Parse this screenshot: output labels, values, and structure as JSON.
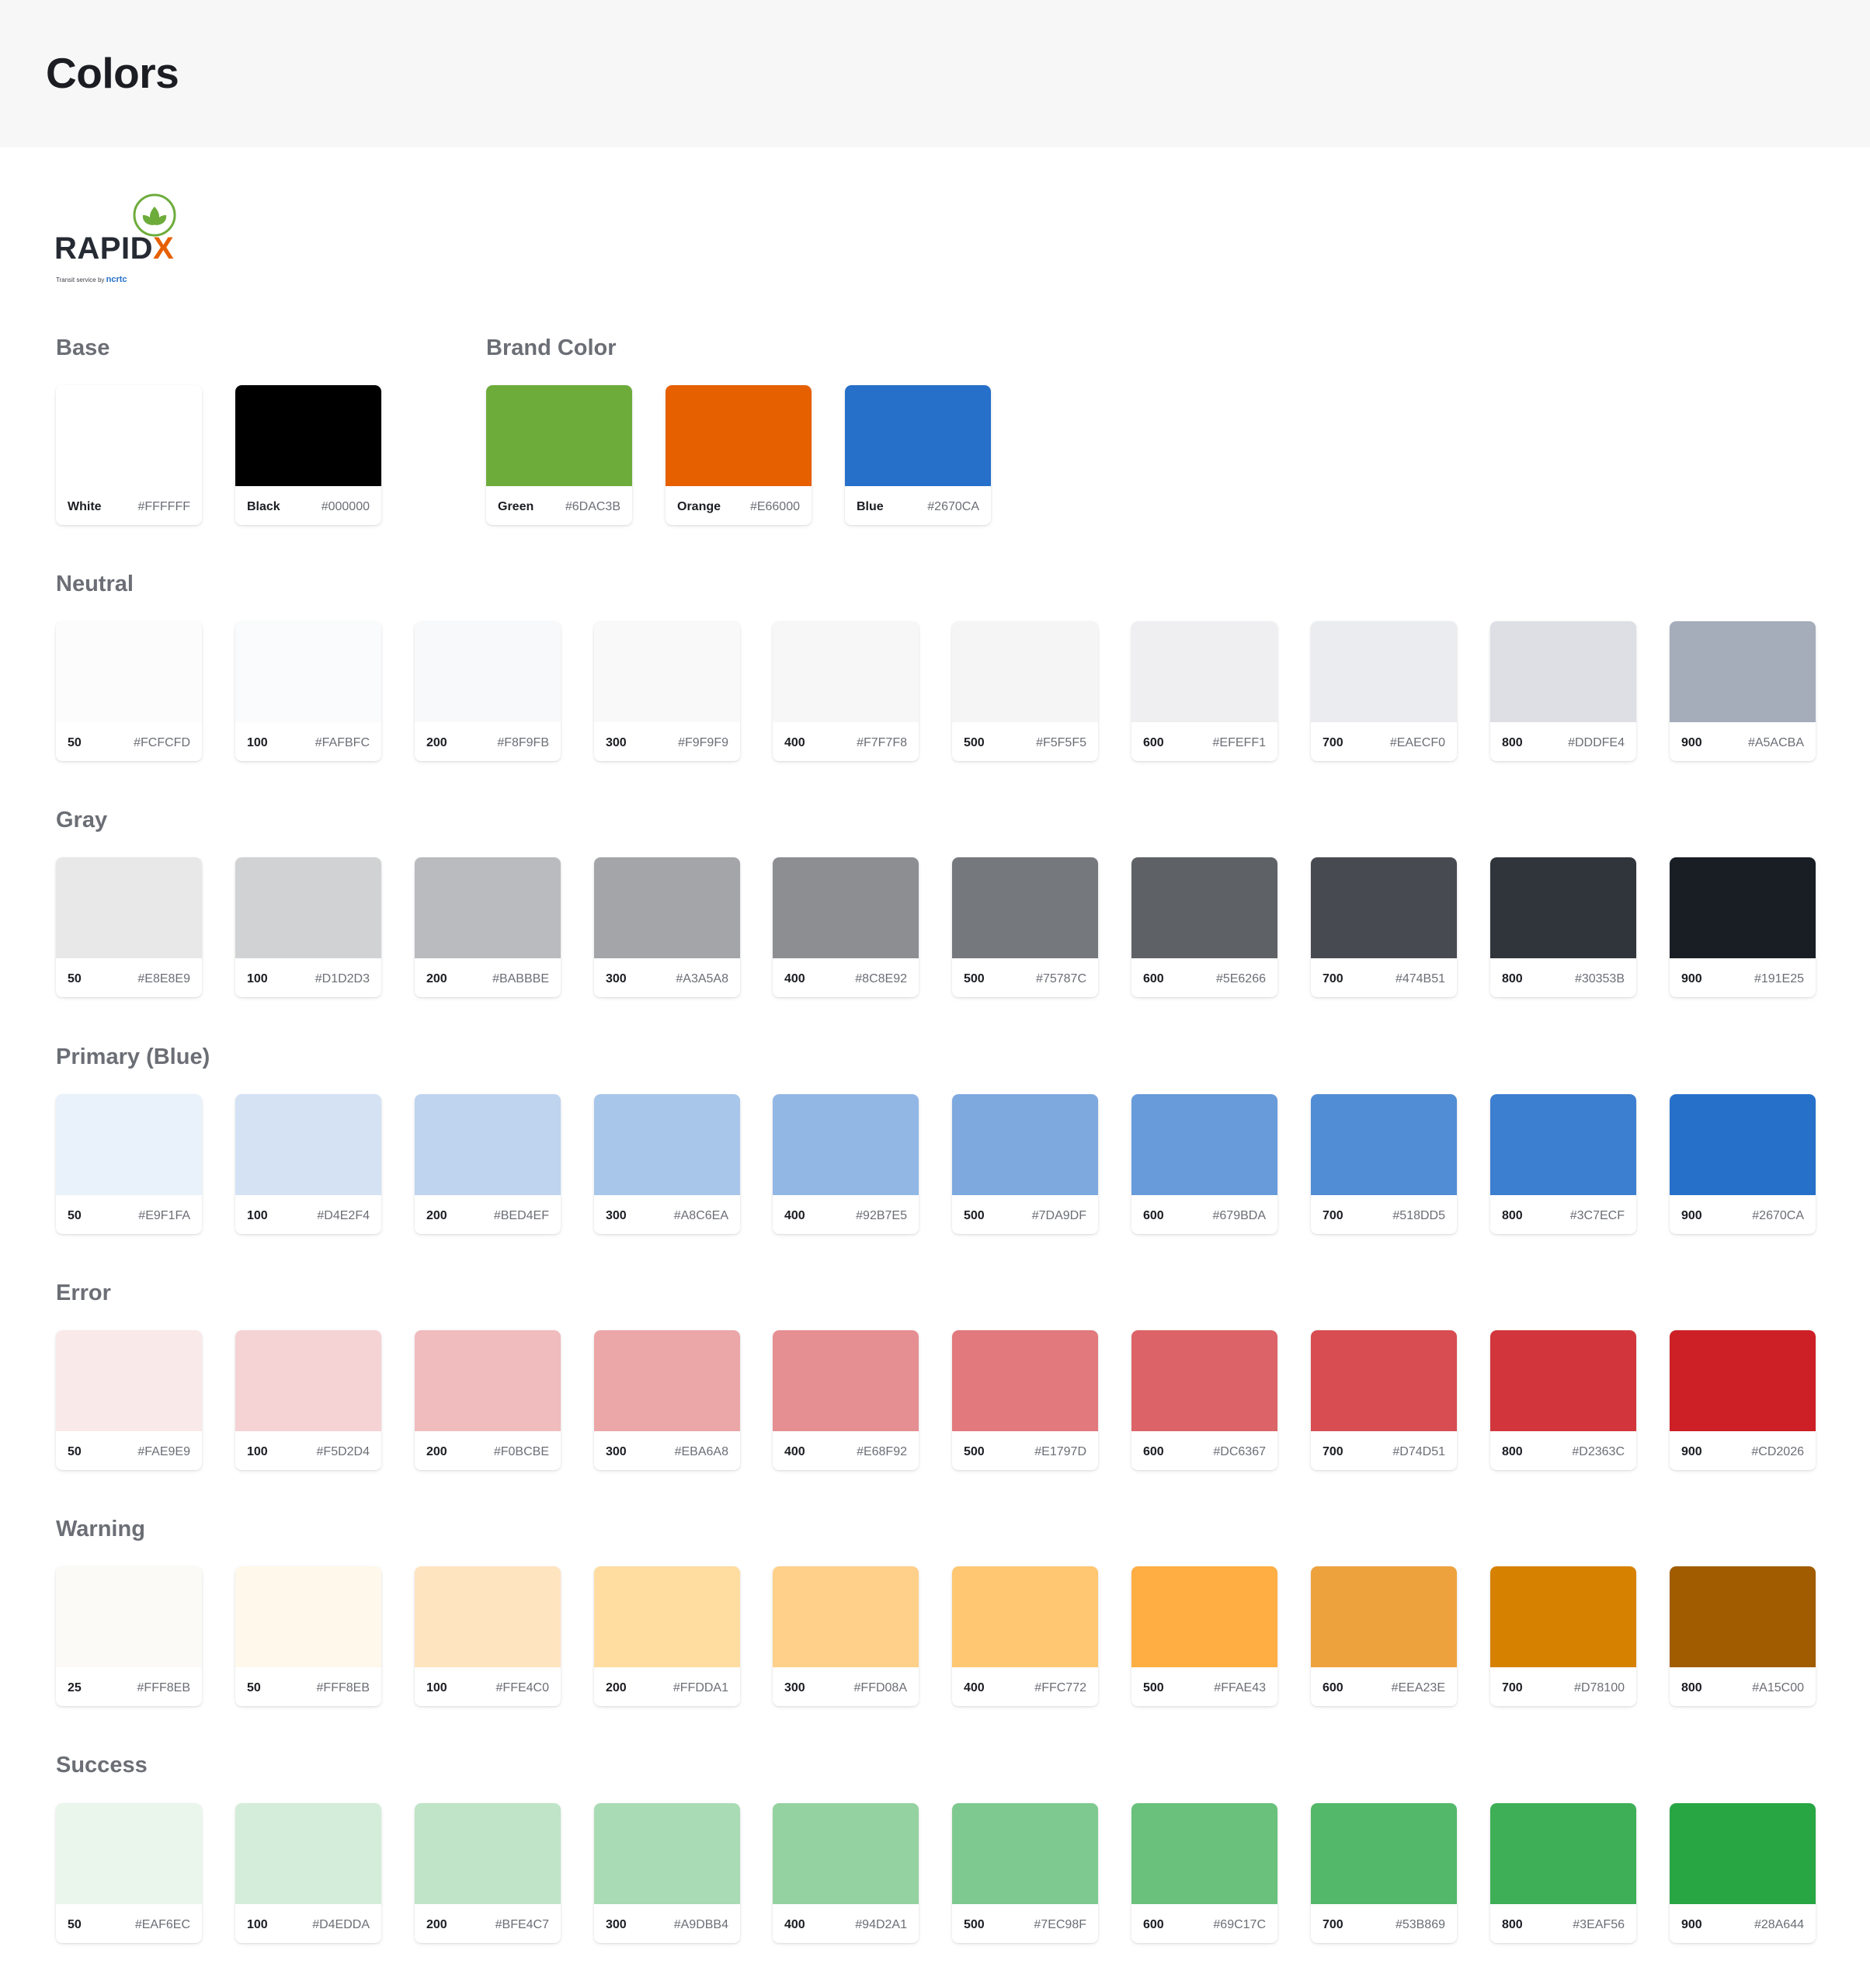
{
  "page": {
    "title": "Colors"
  },
  "logo": {
    "word": "RAPID",
    "word_x": "X",
    "tagline": "Transit service by",
    "tagline_brand": "ncrtc"
  },
  "sections": [
    {
      "title": "Base",
      "swatches": [
        {
          "name": "White",
          "hex": "#FFFFFF",
          "color": "#FFFFFF"
        },
        {
          "name": "Black",
          "hex": "#000000",
          "color": "#000000"
        }
      ]
    },
    {
      "title": "Brand Color",
      "swatches": [
        {
          "name": "Green",
          "hex": "#6DAC3B",
          "color": "#6DAC3B"
        },
        {
          "name": "Orange",
          "hex": "#E66000",
          "color": "#E66000"
        },
        {
          "name": "Blue",
          "hex": "#2670CA",
          "color": "#2670CA"
        }
      ]
    },
    {
      "title": "Neutral",
      "swatches": [
        {
          "name": "50",
          "hex": "#FCFCFD",
          "color": "#FCFCFD"
        },
        {
          "name": "100",
          "hex": "#FAFBFC",
          "color": "#FAFBFC"
        },
        {
          "name": "200",
          "hex": "#F8F9FB",
          "color": "#F8F9FB"
        },
        {
          "name": "300",
          "hex": "#F9F9F9",
          "color": "#F9F9F9"
        },
        {
          "name": "400",
          "hex": "#F7F7F8",
          "color": "#F7F7F8"
        },
        {
          "name": "500",
          "hex": "#F5F5F5",
          "color": "#F5F5F5"
        },
        {
          "name": "600",
          "hex": "#EFEFF1",
          "color": "#EFEFF1"
        },
        {
          "name": "700",
          "hex": "#EAECF0",
          "color": "#EAECF0"
        },
        {
          "name": "800",
          "hex": "#DDDFE4",
          "color": "#DDDFE4"
        },
        {
          "name": "900",
          "hex": "#A5ACBA",
          "color": "#A5ACBA"
        }
      ]
    },
    {
      "title": "Gray",
      "swatches": [
        {
          "name": "50",
          "hex": "#E8E8E9",
          "color": "#E8E8E9"
        },
        {
          "name": "100",
          "hex": "#D1D2D3",
          "color": "#D1D2D3"
        },
        {
          "name": "200",
          "hex": "#BABBBE",
          "color": "#BABBBE"
        },
        {
          "name": "300",
          "hex": "#A3A5A8",
          "color": "#A3A5A8"
        },
        {
          "name": "400",
          "hex": "#8C8E92",
          "color": "#8C8E92"
        },
        {
          "name": "500",
          "hex": "#75787C",
          "color": "#75787C"
        },
        {
          "name": "600",
          "hex": "#5E6266",
          "color": "#5E6266"
        },
        {
          "name": "700",
          "hex": "#474B51",
          "color": "#474B51"
        },
        {
          "name": "800",
          "hex": "#30353B",
          "color": "#30353B"
        },
        {
          "name": "900",
          "hex": "#191E25",
          "color": "#191E25"
        }
      ]
    },
    {
      "title": "Primary (Blue)",
      "swatches": [
        {
          "name": "50",
          "hex": "#E9F1FA",
          "color": "#E9F1FA"
        },
        {
          "name": "100",
          "hex": "#D4E2F4",
          "color": "#D4E2F4"
        },
        {
          "name": "200",
          "hex": "#BED4EF",
          "color": "#BED4EF"
        },
        {
          "name": "300",
          "hex": "#A8C6EA",
          "color": "#A8C6EA"
        },
        {
          "name": "400",
          "hex": "#92B7E5",
          "color": "#92B7E5"
        },
        {
          "name": "500",
          "hex": "#7DA9DF",
          "color": "#7DA9DF"
        },
        {
          "name": "600",
          "hex": "#679BDA",
          "color": "#679BDA"
        },
        {
          "name": "700",
          "hex": "#518DD5",
          "color": "#518DD5"
        },
        {
          "name": "800",
          "hex": "#3C7ECF",
          "color": "#3C7ECF"
        },
        {
          "name": "900",
          "hex": "#2670CA",
          "color": "#2670CA"
        }
      ]
    },
    {
      "title": "Error",
      "swatches": [
        {
          "name": "50",
          "hex": "#FAE9E9",
          "color": "#FAE9E9"
        },
        {
          "name": "100",
          "hex": "#F5D2D4",
          "color": "#F5D2D4"
        },
        {
          "name": "200",
          "hex": "#F0BCBE",
          "color": "#F0BCBE"
        },
        {
          "name": "300",
          "hex": "#EBA6A8",
          "color": "#EBA6A8"
        },
        {
          "name": "400",
          "hex": "#E68F92",
          "color": "#E68F92"
        },
        {
          "name": "500",
          "hex": "#E1797D",
          "color": "#E1797D"
        },
        {
          "name": "600",
          "hex": "#DC6367",
          "color": "#DC6367"
        },
        {
          "name": "700",
          "hex": "#D74D51",
          "color": "#D74D51"
        },
        {
          "name": "800",
          "hex": "#D2363C",
          "color": "#D2363C"
        },
        {
          "name": "900",
          "hex": "#CD2026",
          "color": "#CD2026"
        }
      ]
    },
    {
      "title": "Warning",
      "swatches": [
        {
          "name": "25",
          "hex": "#FFF8EB",
          "color": "#FCFAF7"
        },
        {
          "name": "50",
          "hex": "#FFF8EB",
          "color": "#FFF8EB"
        },
        {
          "name": "100",
          "hex": "#FFE4C0",
          "color": "#FFE4C0"
        },
        {
          "name": "200",
          "hex": "#FFDDA1",
          "color": "#FFDDA1"
        },
        {
          "name": "300",
          "hex": "#FFD08A",
          "color": "#FFD08A"
        },
        {
          "name": "400",
          "hex": "#FFC772",
          "color": "#FFC772"
        },
        {
          "name": "500",
          "hex": "#FFAE43",
          "color": "#FFAE43"
        },
        {
          "name": "600",
          "hex": "#EEA23E",
          "color": "#EEA23E"
        },
        {
          "name": "700",
          "hex": "#D78100",
          "color": "#D78100"
        },
        {
          "name": "800",
          "hex": "#A15C00",
          "color": "#A15C00"
        }
      ]
    },
    {
      "title": "Success",
      "swatches": [
        {
          "name": "50",
          "hex": "#EAF6EC",
          "color": "#EAF6EC"
        },
        {
          "name": "100",
          "hex": "#D4EDDA",
          "color": "#D4EDDA"
        },
        {
          "name": "200",
          "hex": "#BFE4C7",
          "color": "#BFE4C7"
        },
        {
          "name": "300",
          "hex": "#A9DBB4",
          "color": "#A9DBB4"
        },
        {
          "name": "400",
          "hex": "#94D2A1",
          "color": "#94D2A1"
        },
        {
          "name": "500",
          "hex": "#7EC98F",
          "color": "#7EC98F"
        },
        {
          "name": "600",
          "hex": "#69C17C",
          "color": "#69C17C"
        },
        {
          "name": "700",
          "hex": "#53B869",
          "color": "#53B869"
        },
        {
          "name": "800",
          "hex": "#3EAF56",
          "color": "#3EAF56"
        },
        {
          "name": "900",
          "hex": "#28A644",
          "color": "#28A644"
        }
      ]
    }
  ]
}
